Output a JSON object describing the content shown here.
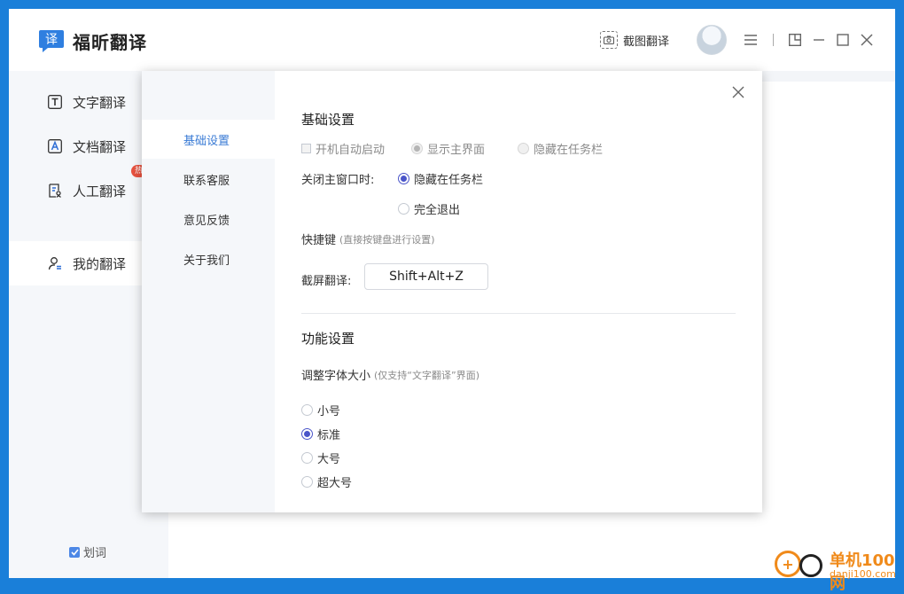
{
  "app": {
    "name": "福昕翻译",
    "logo_char": "译"
  },
  "header": {
    "screenshot_translate": "截图翻译"
  },
  "sidebar": {
    "items": [
      {
        "label": "文字翻译",
        "icon": "text-translate-icon"
      },
      {
        "label": "文档翻译",
        "icon": "document-translate-icon"
      },
      {
        "label": "人工翻译",
        "icon": "human-translate-icon",
        "badge": "热"
      },
      {
        "label": "我的翻译",
        "icon": "my-translate-icon"
      }
    ],
    "word_select": "划词"
  },
  "dialog": {
    "nav": [
      "基础设置",
      "联系客服",
      "意见反馈",
      "关于我们"
    ],
    "basic": {
      "title": "基础设置",
      "autostart": "开机自动启动",
      "show_main": "显示主界面",
      "hide_taskbar": "隐藏在任务栏",
      "close_label": "关闭主窗口时:",
      "close_hide": "隐藏在任务栏",
      "close_exit": "完全退出",
      "shortcut_title": "快捷键",
      "shortcut_hint": "(直接按键盘进行设置)",
      "screenshot_label": "截屏翻译:",
      "screenshot_key": "Shift+Alt+Z"
    },
    "function": {
      "title": "功能设置",
      "font_size_label": "调整字体大小",
      "font_size_hint": "(仅支持“文字翻译”界面)",
      "options": [
        "小号",
        "标准",
        "大号",
        "超大号"
      ],
      "selected": "标准"
    }
  },
  "watermark": {
    "brand": "单机100网",
    "url": "danji100.com"
  },
  "colors": {
    "accent": "#4a55c9",
    "active_nav": "#3a7bd5",
    "desktop": "#1a7fd9"
  }
}
